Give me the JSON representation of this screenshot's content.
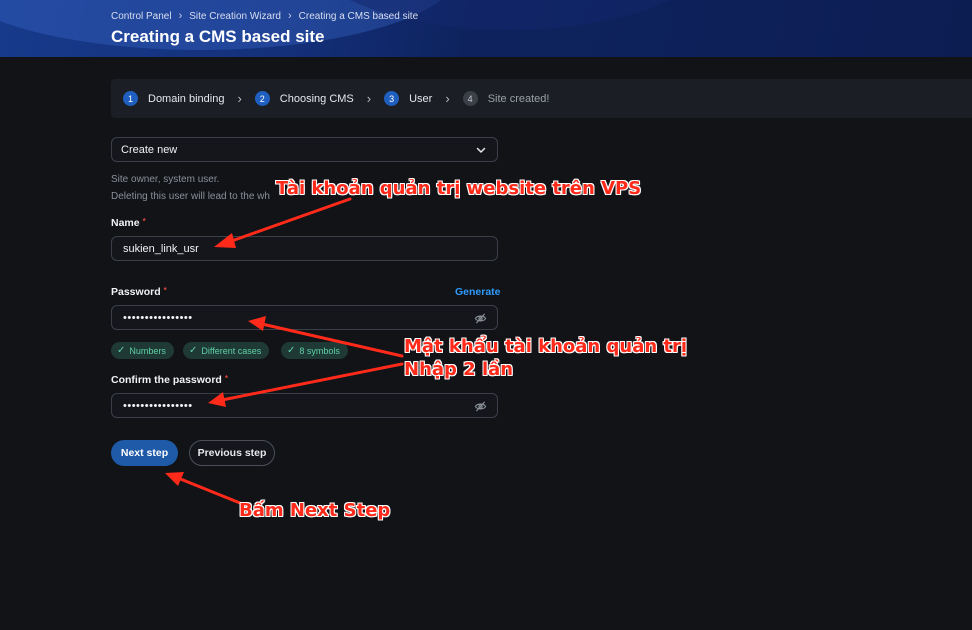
{
  "header": {
    "breadcrumb": [
      "Control Panel",
      "Site Creation Wizard",
      "Creating a CMS based site"
    ],
    "breadcrumb_separator": "›",
    "title": "Creating a CMS based site"
  },
  "stepper": {
    "steps": [
      {
        "number": "1",
        "label": "Domain binding",
        "state": "done"
      },
      {
        "number": "2",
        "label": "Choosing CMS",
        "state": "done"
      },
      {
        "number": "3",
        "label": "User",
        "state": "current"
      },
      {
        "number": "4",
        "label": "Site created!",
        "state": "pending"
      }
    ],
    "separator": "›"
  },
  "form": {
    "user_select": {
      "value": "Create new",
      "icon": "chevron-down-icon"
    },
    "hint_line1": "Site owner, system user.",
    "hint_line2": "Deleting this user will lead to the wh",
    "name_label": "Name",
    "required_mark": "*",
    "name_value": "sukien_link_usr",
    "password_label": "Password",
    "generate_label": "Generate",
    "password_value": "••••••••••••••••",
    "password_rules": [
      "Numbers",
      "Different cases",
      "8 symbols"
    ],
    "confirm_label": "Confirm the password",
    "confirm_value": "••••••••••••••••",
    "eye_icon": "eye-off-icon"
  },
  "actions": {
    "next_label": "Next step",
    "previous_label": "Previous step"
  },
  "annotations": {
    "account_note": "Tài khoản quản trị website trên VPS",
    "password_note_line1": "Mật khẩu tài khoản quản trị",
    "password_note_line2": "Nhập 2 lần",
    "next_note": "Bấm Next Step",
    "color": "#ff2a1a"
  },
  "colors": {
    "accent": "#2f9bff",
    "primary_button": "#1e5aa8",
    "badge_text": "#5fd1a6",
    "step_active": "#1f5fbf"
  }
}
